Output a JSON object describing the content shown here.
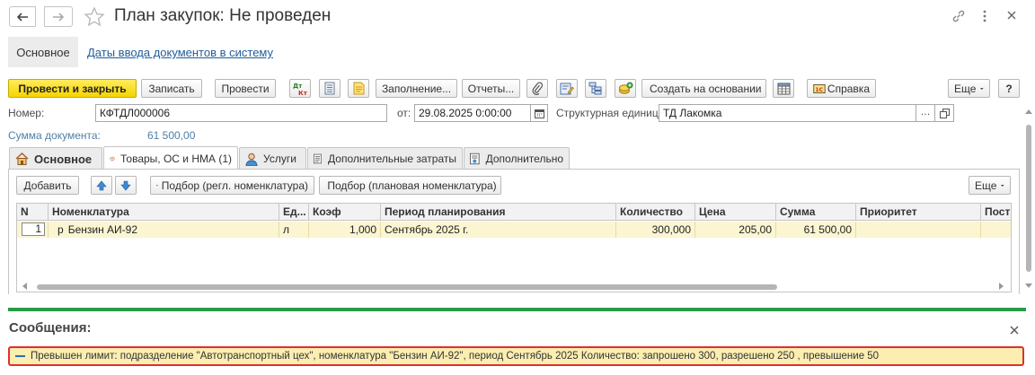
{
  "window": {
    "title": "План закупок: Не проведен"
  },
  "nav": {
    "main_label": "Основное",
    "dates_link": "Даты ввода документов в систему"
  },
  "toolbar": {
    "post_close": "Провести и закрыть",
    "save": "Записать",
    "post": "Провести",
    "fill": "Заполнение...",
    "reports": "Отчеты...",
    "create_based": "Создать на основании",
    "help": "Справка",
    "more": "Еще",
    "question": "?"
  },
  "form": {
    "number_label": "Номер:",
    "number_value": "КФТДЛ000006",
    "date_label": "от:",
    "date_value": "29.08.2025  0:00:00",
    "unit_label": "Структурная единица:",
    "unit_value": "ТД Лакомка",
    "sum_label": "Сумма документа:",
    "sum_value": "61 500,00"
  },
  "tabs": [
    {
      "label": "Основное"
    },
    {
      "label": "Товары, ОС и НМА (1)"
    },
    {
      "label": "Услуги"
    },
    {
      "label": "Дополнительные затраты"
    },
    {
      "label": "Дополнительно"
    }
  ],
  "table_toolbar": {
    "add": "Добавить",
    "pick_reg": "Подбор (регл. номенклатура)",
    "pick_plan": "Подбор (плановая номенклатура)",
    "more": "Еще"
  },
  "table": {
    "columns": [
      "N",
      "Номенклатура",
      "Ед...",
      "Коэф",
      "Период планирования",
      "Количество",
      "Цена",
      "Сумма",
      "Приоритет",
      "Пост"
    ],
    "rows": [
      {
        "n": "1",
        "marker": "р",
        "item": "Бензин АИ-92",
        "unit": "л",
        "coef": "1,000",
        "period": "Сентябрь 2025 г.",
        "qty": "300,000",
        "price": "205,00",
        "sum": "61 500,00",
        "priority": "",
        "supplier": ""
      }
    ]
  },
  "messages": {
    "title": "Сообщения:",
    "items": [
      {
        "text": "Превышен лимит: подразделение \"Автотранспортный цех\", номенклатура \"Бензин АИ-92\", период Сентябрь 2025 Количество: запрошено 300, разрешено 250 , превышение 50"
      }
    ]
  },
  "colors": {
    "accent_green": "#2a9b45",
    "primary_yellow": "#f5d400",
    "selected_row": "#fbf5d2",
    "error_border": "#e0302b",
    "message_bg": "#fbeeb0",
    "link_blue": "#1f5e9b"
  }
}
